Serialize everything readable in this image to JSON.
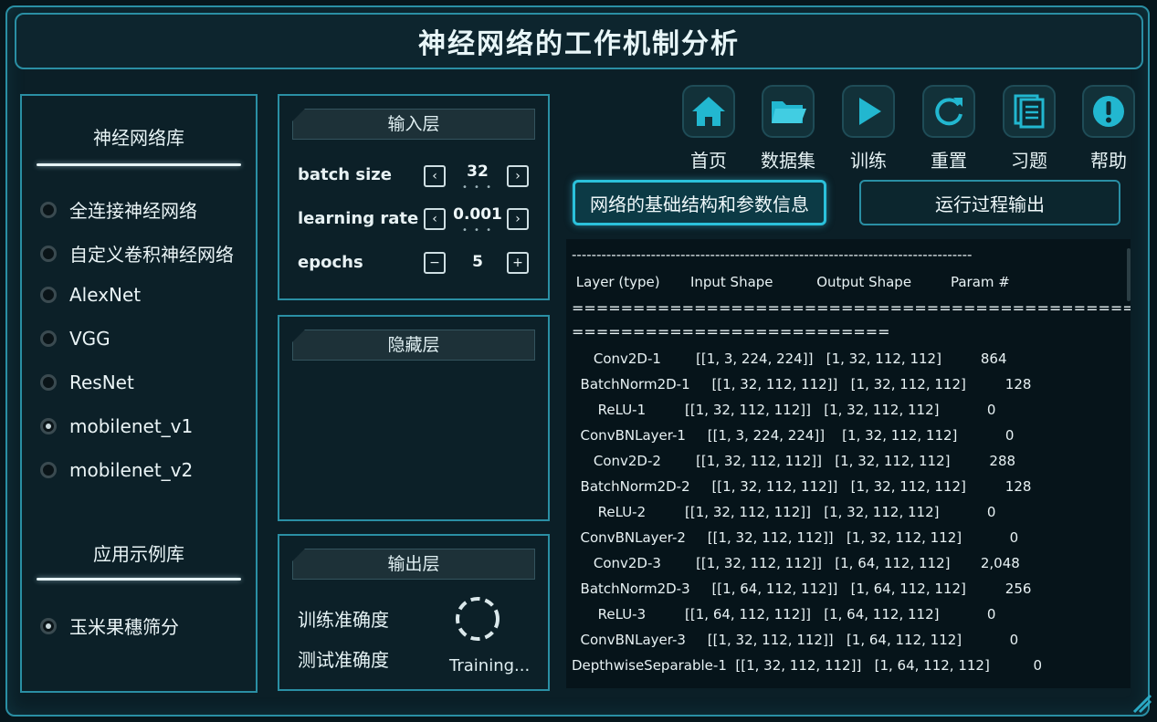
{
  "app": {
    "title": "神经网络的工作机制分析"
  },
  "library": {
    "title": "神经网络库",
    "items": [
      {
        "label": "全连接神经网络",
        "selected": false
      },
      {
        "label": "自定义卷积神经网络",
        "selected": false
      },
      {
        "label": "AlexNet",
        "selected": false
      },
      {
        "label": "VGG",
        "selected": false
      },
      {
        "label": "ResNet",
        "selected": false
      },
      {
        "label": "mobilenet_v1",
        "selected": true
      },
      {
        "label": "mobilenet_v2",
        "selected": false
      }
    ],
    "examples_title": "应用示例库",
    "examples": [
      {
        "label": "玉米果穗筛分",
        "selected": true
      }
    ]
  },
  "input_layer": {
    "title": "输入层",
    "params": [
      {
        "label": "batch size",
        "value": "32",
        "dec": "‹",
        "inc": "›",
        "dots": "• • •"
      },
      {
        "label": "learning rate",
        "value": "0.001",
        "dec": "‹",
        "inc": "›",
        "dots": "• • •"
      },
      {
        "label": "epochs",
        "value": "5",
        "dec": "−",
        "inc": "+"
      }
    ]
  },
  "hidden_layer": {
    "title": "隐藏层"
  },
  "output_layer": {
    "title": "输出层",
    "train_acc_label": "训练准确度",
    "test_acc_label": "测试准确度",
    "status": "Training..."
  },
  "toolbar": [
    {
      "label": "首页",
      "icon": "home-icon"
    },
    {
      "label": "数据集",
      "icon": "folder-icon"
    },
    {
      "label": "训练",
      "icon": "play-icon"
    },
    {
      "label": "重置",
      "icon": "refresh-icon"
    },
    {
      "label": "习题",
      "icon": "document-icon"
    },
    {
      "label": "帮助",
      "icon": "exclamation-icon"
    }
  ],
  "tabs": {
    "structure": "网络的基础结构和参数信息",
    "runlog": "运行过程输出"
  },
  "summary": {
    "separator_dash": "---------------------------------------------------------------------------------",
    "header": " Layer (type)       Input Shape          Output Shape         Param #",
    "separator_eq1": "==========================================================",
    "separator_eq2": "==========================",
    "rows": [
      "     Conv2D-1        [[1, 3, 224, 224]]   [1, 32, 112, 112]         864",
      "  BatchNorm2D-1     [[1, 32, 112, 112]]   [1, 32, 112, 112]         128",
      "      ReLU-1         [[1, 32, 112, 112]]   [1, 32, 112, 112]           0",
      "  ConvBNLayer-1     [[1, 3, 224, 224]]    [1, 32, 112, 112]           0",
      "     Conv2D-2        [[1, 32, 112, 112]]   [1, 32, 112, 112]         288",
      "  BatchNorm2D-2     [[1, 32, 112, 112]]   [1, 32, 112, 112]         128",
      "      ReLU-2         [[1, 32, 112, 112]]   [1, 32, 112, 112]           0",
      "  ConvBNLayer-2     [[1, 32, 112, 112]]   [1, 32, 112, 112]           0",
      "     Conv2D-3        [[1, 32, 112, 112]]   [1, 64, 112, 112]       2,048",
      "  BatchNorm2D-3     [[1, 64, 112, 112]]   [1, 64, 112, 112]         256",
      "      ReLU-3         [[1, 64, 112, 112]]   [1, 64, 112, 112]           0",
      "  ConvBNLayer-3     [[1, 32, 112, 112]]   [1, 64, 112, 112]           0",
      "DepthwiseSeparable-1  [[1, 32, 112, 112]]   [1, 64, 112, 112]          0"
    ]
  },
  "colors": {
    "accent": "#2a8fa4",
    "tab_active": "#1b7f92",
    "background": "#07161c"
  }
}
